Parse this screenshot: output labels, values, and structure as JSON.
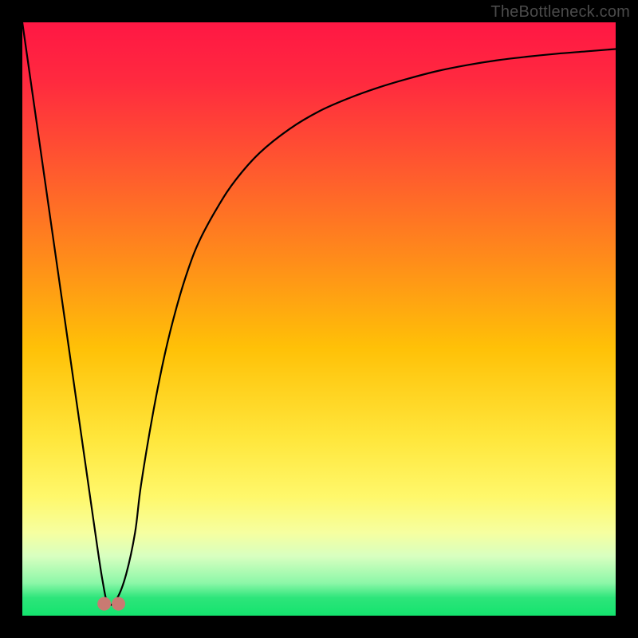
{
  "watermark": {
    "text": "TheBottleneck.com"
  },
  "colors": {
    "gradient_stops": [
      {
        "offset": 0.0,
        "color": "#ff1744"
      },
      {
        "offset": 0.1,
        "color": "#ff2a3f"
      },
      {
        "offset": 0.25,
        "color": "#ff5a2e"
      },
      {
        "offset": 0.4,
        "color": "#ff8c1a"
      },
      {
        "offset": 0.55,
        "color": "#ffc107"
      },
      {
        "offset": 0.7,
        "color": "#ffe63b"
      },
      {
        "offset": 0.8,
        "color": "#fff86b"
      },
      {
        "offset": 0.86,
        "color": "#f6ffa0"
      },
      {
        "offset": 0.9,
        "color": "#d8ffc0"
      },
      {
        "offset": 0.945,
        "color": "#8cf7a8"
      },
      {
        "offset": 0.97,
        "color": "#2de57a"
      },
      {
        "offset": 1.0,
        "color": "#14e36e"
      }
    ],
    "curve": "#000000",
    "marker_fill": "#c97a72",
    "marker_stroke": "#9a4a44"
  },
  "chart_data": {
    "type": "line",
    "title": "",
    "xlabel": "",
    "ylabel": "",
    "xlim": [
      0,
      100
    ],
    "ylim": [
      0,
      100
    ],
    "series": [
      {
        "name": "bottleneck-curve",
        "x": [
          0,
          2,
          4,
          6,
          8,
          10,
          12,
          13.5,
          14.5,
          16,
          17.5,
          19,
          20,
          22,
          24,
          26,
          28,
          30,
          33,
          36,
          40,
          45,
          50,
          55,
          60,
          65,
          70,
          75,
          80,
          85,
          90,
          95,
          100
        ],
        "y": [
          100,
          86,
          72,
          58,
          44,
          30,
          16,
          6,
          2,
          3,
          7,
          14,
          22,
          34,
          44,
          52,
          58.5,
          63.5,
          69,
          73.5,
          78,
          82,
          85,
          87.2,
          89,
          90.5,
          91.8,
          92.8,
          93.6,
          94.2,
          94.7,
          95.1,
          95.5
        ]
      }
    ],
    "markers": [
      {
        "x": 13.8,
        "y": 2.0
      },
      {
        "x": 16.2,
        "y": 2.0
      }
    ]
  }
}
